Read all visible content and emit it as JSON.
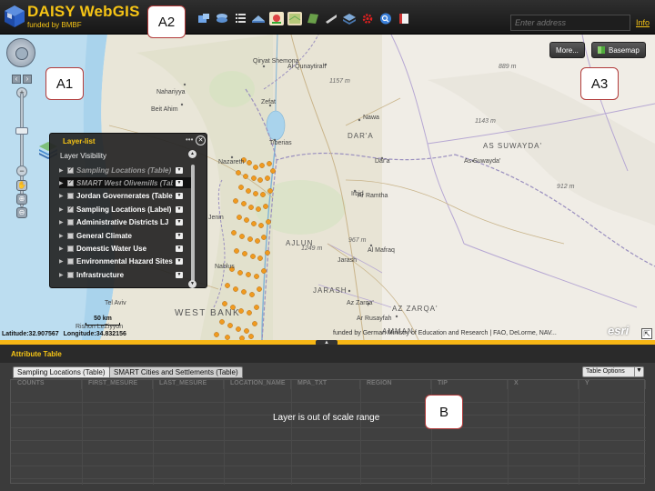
{
  "app": {
    "title": "DAISY WebGIS",
    "subtitle": "funded by BMBF",
    "address_placeholder": "Enter address",
    "info_label": "Info"
  },
  "toolbar": {
    "icons": [
      "identify-icon",
      "layers-stack-icon",
      "list-icon",
      "measure-icon",
      "legend-map-icon",
      "thumbnail-map-icon",
      "overview-map-icon",
      "draw-icon",
      "stack-icon",
      "settings-gear-icon",
      "search-icon",
      "print-icon"
    ]
  },
  "map_buttons": {
    "more_label": "More...",
    "basemap_label": "Basemap"
  },
  "layer_list": {
    "title": "Layer-list",
    "visibility_label": "Layer Visibility",
    "items": [
      {
        "label": "Sampling Locations (Table)",
        "checked": true,
        "dim": true
      },
      {
        "label": "SMART West Olivemills (Table)",
        "checked": true,
        "dim": true
      },
      {
        "label": "Jordan Governerates (Table)",
        "checked": false,
        "dim": false
      },
      {
        "label": "Sampling Locations (Label)",
        "checked": true,
        "dim": false
      },
      {
        "label": "Administrative Districts LJ",
        "checked": false,
        "dim": false
      },
      {
        "label": "General Climate",
        "checked": false,
        "dim": false
      },
      {
        "label": "Domestic Water Use",
        "checked": false,
        "dim": false
      },
      {
        "label": "Environmental Hazard Sites",
        "checked": false,
        "dim": false
      },
      {
        "label": "Infrastructure",
        "checked": false,
        "dim": false
      }
    ]
  },
  "map": {
    "latitude_text": "Latitude:32.907567",
    "longitude_text": "Longitude:34.832156",
    "scale_label": "50 km",
    "attribution": "funded by German Ministry of Education and Research | FAO, DeLorme, NAV...",
    "esri_label": "esri",
    "places": {
      "shemona": "Qiryat Shemona",
      "nahariyya": "Nahariyya",
      "beit_ahim": "Beit Ahim",
      "zefat": "Zefat",
      "tiberias": "Tiberias",
      "nazareth": "Nazareth",
      "jenin": "Jenin",
      "nablus": "Nablus",
      "tel_aviv": "Tel Aviv",
      "west_bank": "WEST BANK",
      "rishon": "Rishon LeZiyyon",
      "irbid": "Irbid",
      "ar_ramtha": "Ar Ramtha",
      "dara_region": "DAR'A",
      "dara_city": "Dar'a",
      "nawa": "Nawa",
      "al_qunaytirah": "Al Qunaytirah",
      "as_suwayda_region": "AS SUWAYDA'",
      "as_suwayda_city": "As Suwayda'",
      "al_mafraq": "Al Mafraq",
      "ajlun": "AJLUN",
      "jarash_region": "JARASH",
      "jarash_city": "Jarash",
      "az_zarqa_region": "AZ ZARQA'",
      "az_zarqa_city": "Az Zarqa'",
      "ar_rusayfah": "Ar Rusayfah",
      "amman": "AMMAN"
    },
    "elevations": {
      "e889": "889 m",
      "e1143": "1143 m",
      "e912": "912 m",
      "e1157": "1157 m",
      "e967": "967 m",
      "e1249": "1249 m"
    }
  },
  "attribute_table": {
    "title": "Attribute Table",
    "tabs": [
      "Sampling Locations (Table)",
      "SMART Cities and Settlements (Table)"
    ],
    "table_options_label": "Table Options",
    "columns": [
      "COUNTS",
      "FIRST_MESURE",
      "LAST_MESURE",
      "LOCATION_NAME",
      "MPA_TXT",
      "REGION",
      "TIP",
      "X",
      "Y"
    ],
    "empty_message": "Layer is out of scale range"
  },
  "callouts": {
    "a1": "A1",
    "a2": "A2",
    "a3": "A3",
    "b": "B"
  },
  "colors": {
    "accent": "#f6c415",
    "sampling_point": "#f09a1f",
    "callout_border": "#b23b3b",
    "topbar": "#1e1e1e",
    "table_bg": "#3b3b3b"
  }
}
